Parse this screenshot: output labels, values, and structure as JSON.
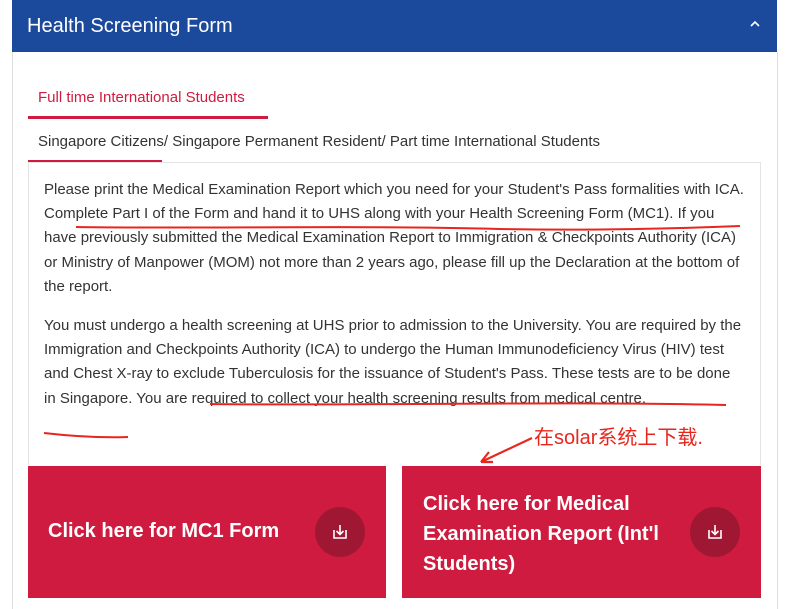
{
  "panel": {
    "title": "Health Screening Form",
    "collapse_icon": "chevron-up-icon"
  },
  "tabs": [
    {
      "label": "Full time International Students"
    },
    {
      "label": "Singapore Citizens/ Singapore Permanent Resident/ Part time International Students"
    }
  ],
  "content": {
    "paragraph1": "Please print the Medical Examination Report which you need for your Student's Pass formalities with ICA. Complete Part I of the Form and hand it to UHS along with your Health Screening Form (MC1). If you have previously submitted the Medical Examination Report to Immigration & Checkpoints Authority (ICA) or Ministry of Manpower (MOM) not more than 2 years ago, please fill up the Declaration at the bottom of the report.",
    "paragraph2": "You must undergo a health screening at UHS prior to admission to the University. You are required by the Immigration and Checkpoints Authority (ICA) to undergo the Human Immunodeficiency Virus (HIV) test and Chest X-ray to exclude Tuberculosis for the issuance of Student's Pass. These tests are to be done in Singapore. You are required to collect your health screening results from medical centre."
  },
  "annotation": {
    "text": "在solar系统上下载.",
    "color": "#e8261e"
  },
  "buttons": [
    {
      "label": "Click here for MC1 Form",
      "icon": "download-icon"
    },
    {
      "label": "Click here for Medical Examination Report (Int'l Students)",
      "icon": "download-icon"
    }
  ],
  "colors": {
    "header_bg": "#1b4a9c",
    "accent": "#cf1b3f",
    "button_icon_bg": "#9f1733"
  }
}
